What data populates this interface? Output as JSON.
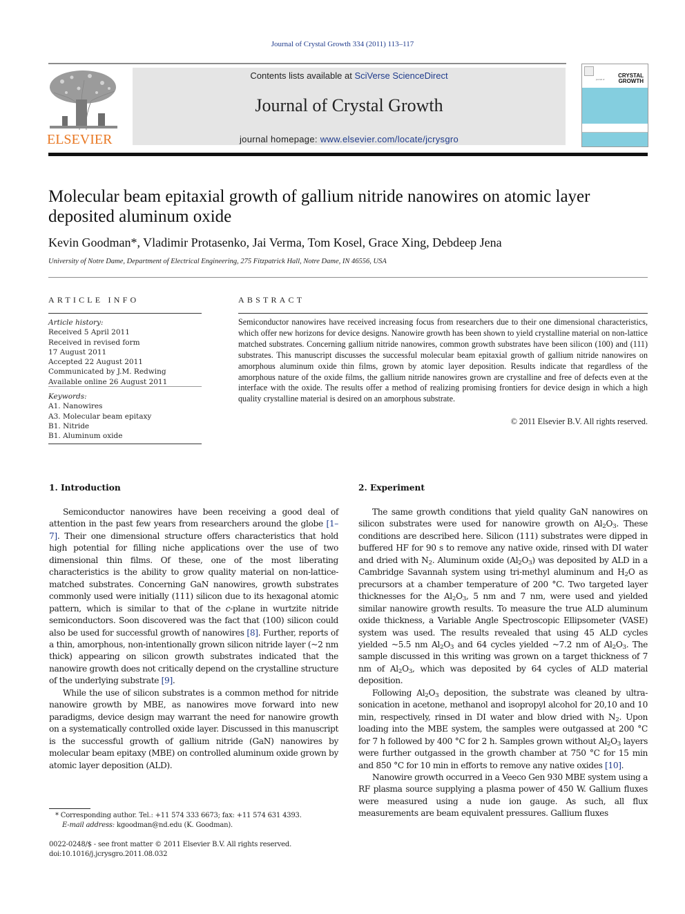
{
  "header": {
    "citation": "Journal of Crystal Growth 334 (2011) 113–117",
    "publisher_logo_text": "ELSEVIER",
    "contents_prefix": "Contents lists available at ",
    "contents_link": "SciVerse ScienceDirect",
    "journal_title": "Journal of Crystal Growth",
    "homepage_prefix": "journal homepage: ",
    "homepage_link": "www.elsevier.com/locate/jcrysgro",
    "cover_title_line1": "CRYSTAL",
    "cover_title_line2": "GROWTH",
    "cover_small": "journal of",
    "colors": {
      "link": "#1f3b8c",
      "elsevier_orange": "#e87722",
      "banner_gray": "#e5e5e5",
      "cover_blue": "#84cedf"
    }
  },
  "article": {
    "title": "Molecular beam epitaxial growth of gallium nitride nanowires on atomic layer deposited aluminum oxide",
    "authors": "Kevin Goodman*, Vladimir Protasenko, Jai Verma, Tom Kosel, Grace Xing, Debdeep Jena",
    "affiliation": "University of Notre Dame, Department of Electrical Engineering, 275 Fitzpatrick Hall, Notre Dame, IN 46556, USA"
  },
  "article_info": {
    "heading": "ARTICLE INFO",
    "history_label": "Article history:",
    "history": [
      "Received 5 April 2011",
      "Received in revised form",
      "17 August 2011",
      "Accepted 22 August 2011",
      "Communicated by J.M. Redwing",
      "Available online 26 August 2011"
    ],
    "keywords_label": "Keywords:",
    "keywords": [
      "A1. Nanowires",
      "A3. Molecular beam epitaxy",
      "B1. Nitride",
      "B1. Aluminum oxide"
    ]
  },
  "abstract": {
    "heading": "ABSTRACT",
    "text": "Semiconductor nanowires have received increasing focus from researchers due to their one dimensional characteristics, which offer new horizons for device designs. Nanowire growth has been shown to yield crystalline material on non-lattice matched substrates. Concerning gallium nitride nanowires, common growth substrates have been silicon (100) and (111) substrates. This manuscript discusses the successful molecular beam epitaxial growth of gallium nitride nanowires on amorphous aluminum oxide thin films, grown by atomic layer deposition. Results indicate that regardless of the amorphous nature of the oxide films, the gallium nitride nanowires grown are crystalline and free of defects even at the interface with the oxide. The results offer a method of realizing promising frontiers for device design in which a high quality crystalline material is desired on an amorphous substrate.",
    "copyright": "© 2011 Elsevier B.V. All rights reserved."
  },
  "sections": {
    "intro": {
      "title": "1.  Introduction",
      "p1": [
        "Semiconductor nanowires have been receiving a good deal of attention in the past few years from researchers around the globe ",
        "[1–7]",
        ". Their one dimensional structure offers characteristics that hold high potential for filling niche applications over the use of two dimensional thin films. Of these, one of the most liberating characteristics is the ability to grow quality material on non-lattice-matched substrates. Concerning GaN nanowires, growth substrates commonly used were initially (111) silicon due to its hexagonal atomic pattern, which is similar to that of the ",
        "c",
        "-plane in wurtzite nitride semiconductors. Soon discovered was the fact that (100) silicon could also be used for successful growth of nanowires ",
        "[8]",
        ". Further, reports of a thin, amorphous, non-intentionally grown silicon nitride layer (~2 nm thick) appearing on silicon growth substrates indicated that the nanowire growth does not critically depend on the crystalline structure of the underlying substrate ",
        "[9]",
        "."
      ],
      "p2": "While the use of silicon substrates is a common method for nitride nanowire growth by MBE, as nanowires move forward into new paradigms, device design may warrant the need for nanowire growth on a systematically controlled oxide layer. Discussed in this manuscript is the successful growth of gallium nitride (GaN) nanowires by molecular beam epitaxy (MBE) on controlled aluminum oxide grown by atomic layer deposition (ALD)."
    },
    "experiment": {
      "title": "2.  Experiment",
      "p1": [
        "The same growth conditions that yield quality GaN nanowires on silicon substrates were used for nanowire growth on Al",
        "2",
        "O",
        "3",
        ". These conditions are described here. Silicon (111) substrates were dipped in buffered HF for 90 s to remove any native oxide, rinsed with DI water and dried with N",
        "2",
        ". Aluminum oxide (Al",
        "2",
        "O",
        "3",
        ") was deposited by ALD in a Cambridge Savannah system using tri-methyl aluminum and H",
        "2",
        "O as precursors at a chamber temperature of 200 °C. Two targeted layer thicknesses for the Al",
        "2",
        "O",
        "3",
        ", 5 nm and 7 nm, were used and yielded similar nanowire growth results. To measure the true ALD aluminum oxide thickness, a Variable Angle Spectroscopic Ellipsometer (VASE) system was used. The results revealed that using 45 ALD cycles yielded ~5.5 nm Al",
        "2",
        "O",
        "3",
        " and 64 cycles yielded ~7.2 nm of Al",
        "2",
        "O",
        "3",
        ". The sample discussed in this writing was grown on a target thickness of 7 nm of Al",
        "2",
        "O",
        "3",
        ", which was deposited by 64 cycles of ALD material deposition."
      ],
      "p2": [
        "Following Al",
        "2",
        "O",
        "3",
        " deposition, the substrate was cleaned by ultra-sonication in acetone, methanol and isopropyl alcohol for 20,10 and 10 min, respectively, rinsed in DI water and blow dried with N",
        "2",
        ". Upon loading into the MBE system, the samples were outgassed at 200 °C for 7 h followed by 400 °C for 2 h. Samples grown without Al",
        "2",
        "O",
        "3",
        " layers were further outgassed in the growth chamber at 750 °C for 15 min and 850 °C for 10 min in efforts to remove any native oxides ",
        "[10]",
        "."
      ],
      "p3": "Nanowire growth occurred in a Veeco Gen 930 MBE system using a RF plasma source supplying a plasma power of 450 W. Gallium fluxes were measured using a nude ion gauge. As such, all flux measurements are beam equivalent pressures. Gallium fluxes"
    }
  },
  "footnotes": {
    "corresponding": "* Corresponding author. Tel.: +11 574 333 6673; fax: +11 574 631 4393.",
    "email_label": "E-mail address:",
    "email": " kgoodman@nd.edu (K. Goodman).",
    "issn": "0022-0248/$ - see front matter © 2011 Elsevier B.V. All rights reserved.",
    "doi": "doi:10.1016/j.jcrysgro.2011.08.032"
  }
}
